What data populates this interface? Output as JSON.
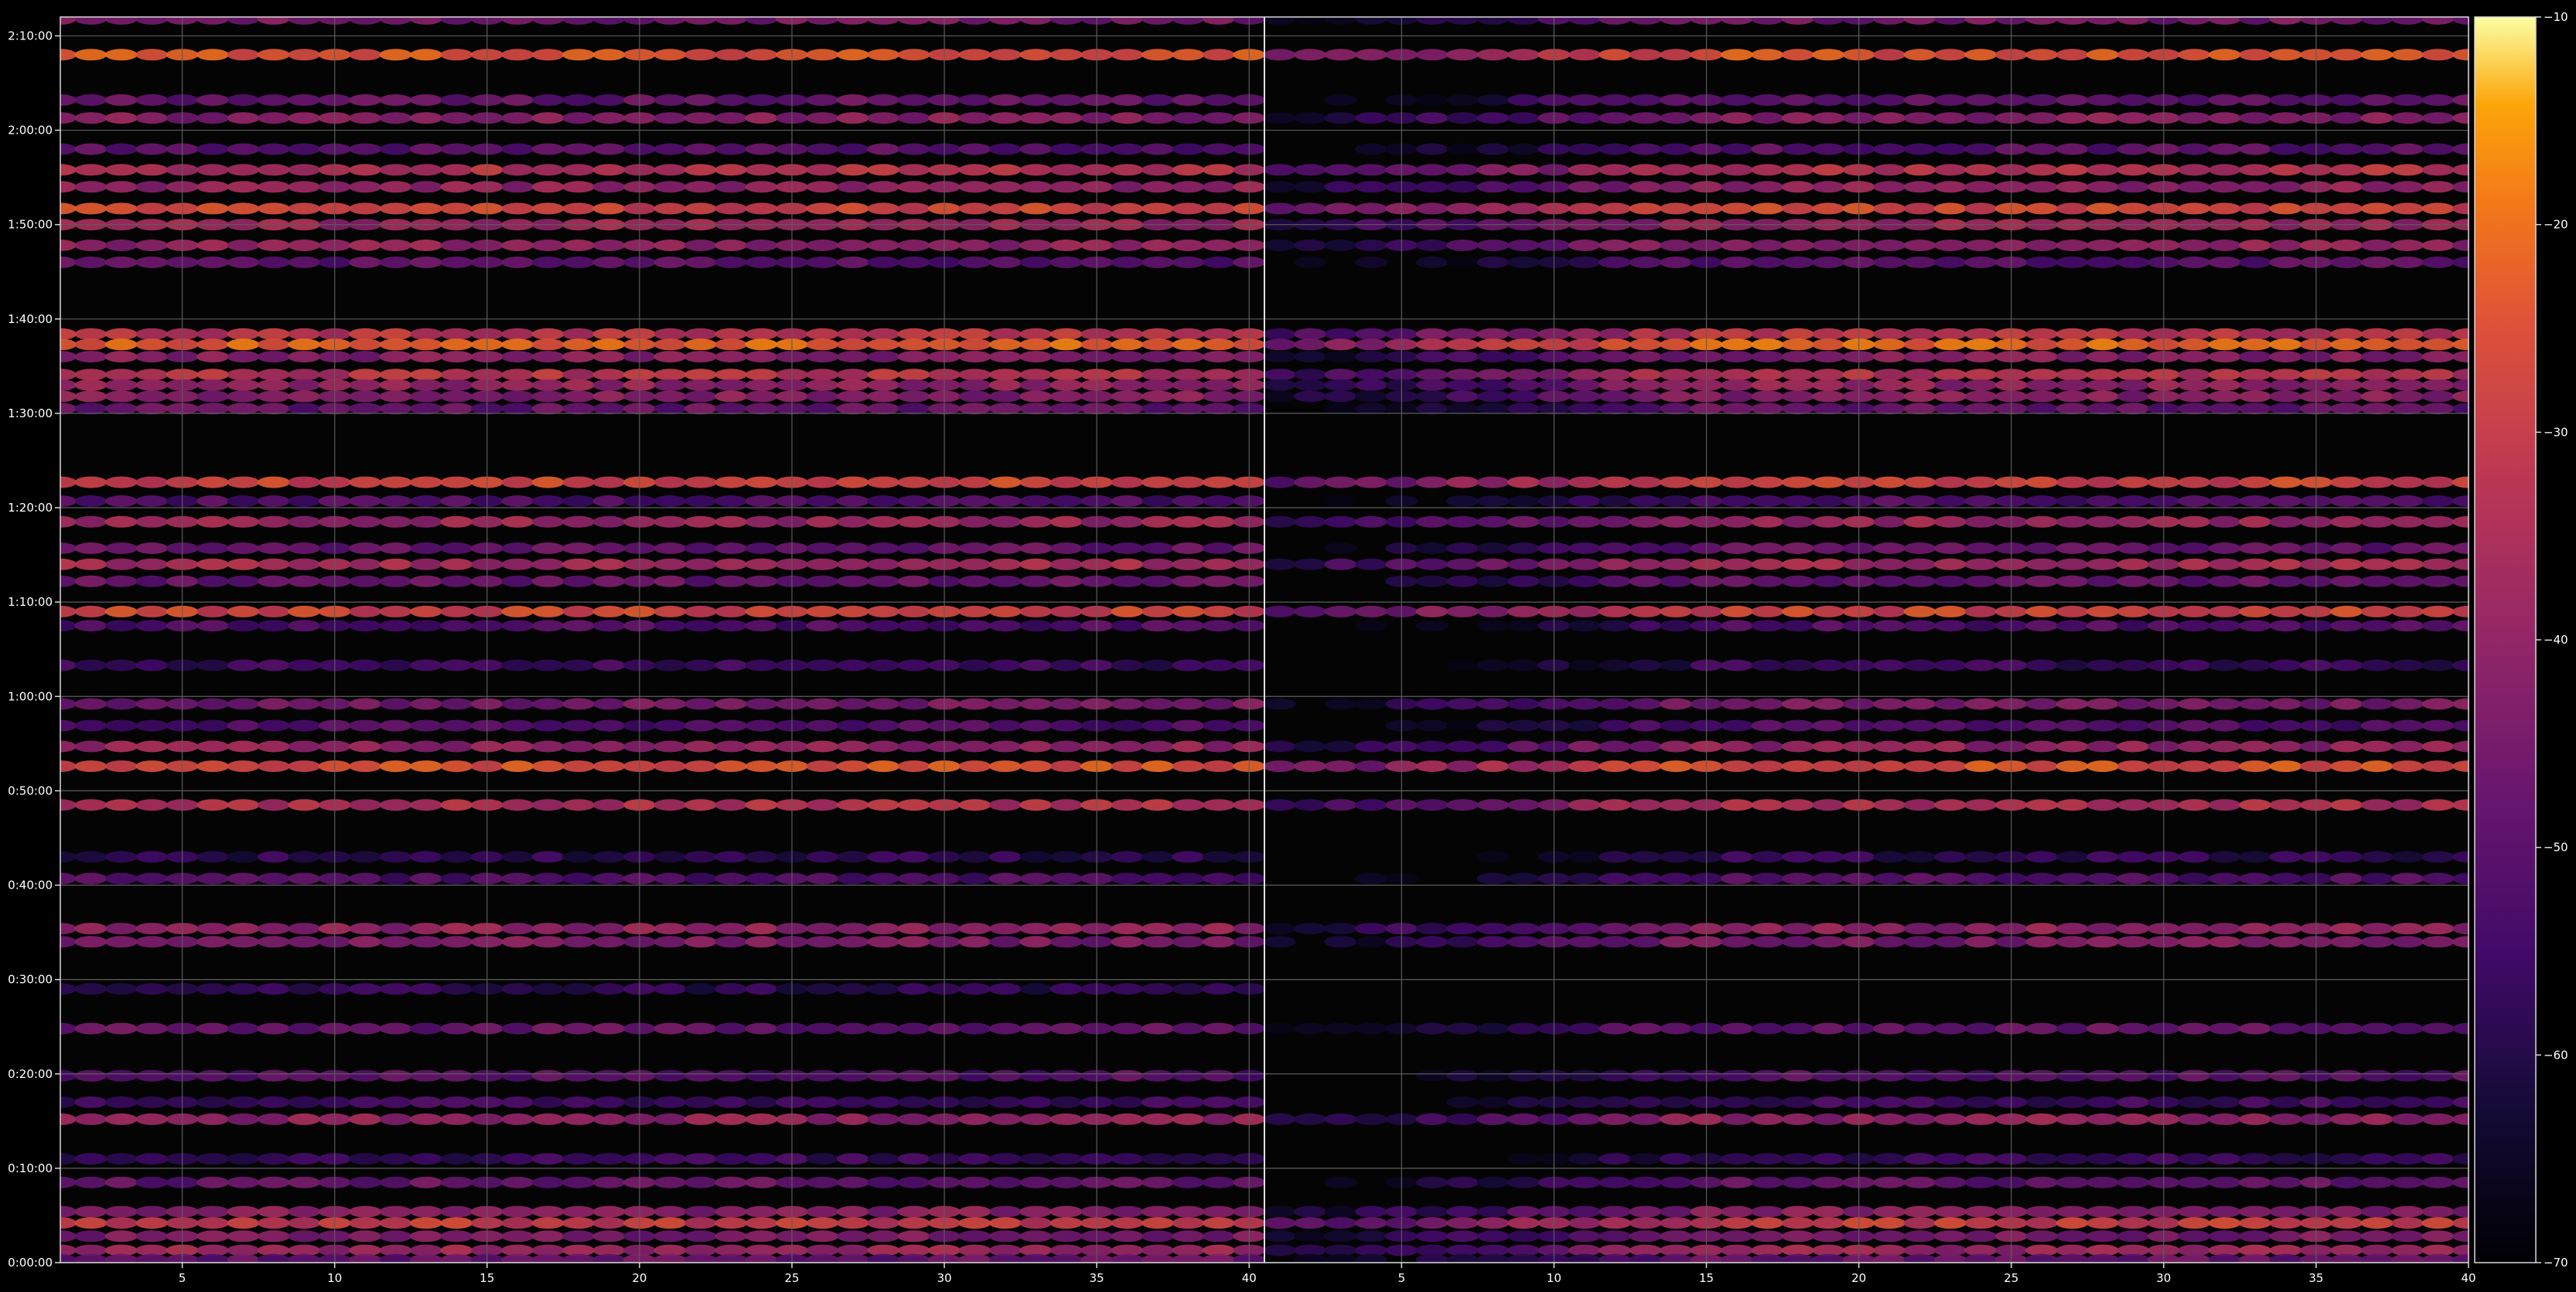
{
  "chart_data": {
    "type": "heatmap",
    "title": "",
    "xlabel": "",
    "ylabel": "",
    "x_range": [
      1,
      80
    ],
    "x_split": 40,
    "xticks": [
      5,
      10,
      15,
      20,
      25,
      30,
      35,
      40,
      45,
      50,
      55,
      60,
      65,
      70,
      75,
      80
    ],
    "xtick_labels": [
      "5",
      "10",
      "15",
      "20",
      "25",
      "30",
      "35",
      "40",
      "5",
      "10",
      "15",
      "20",
      "25",
      "30",
      "35",
      "40"
    ],
    "y_unit": "minutes",
    "y_range": [
      0,
      132
    ],
    "yticks": [
      0,
      10,
      20,
      30,
      40,
      50,
      60,
      70,
      80,
      90,
      100,
      110,
      120,
      130
    ],
    "ytick_labels": [
      "0:00:00",
      "0:10:00",
      "0:20:00",
      "0:30:00",
      "0:40:00",
      "0:50:00",
      "1:00:00",
      "1:10:00",
      "1:20:00",
      "1:30:00",
      "1:40:00",
      "1:50:00",
      "2:00:00",
      "2:10:00"
    ],
    "grid": true,
    "colormap": "inferno",
    "colorbar": {
      "range": [
        -70,
        -10
      ],
      "ticks": [
        -70,
        -60,
        -50,
        -40,
        -30,
        -20,
        -10
      ],
      "tick_labels": [
        "−70",
        "−60",
        "−50",
        "−40",
        "−30",
        "−20",
        "−10"
      ]
    },
    "bands": [
      {
        "y": 131.8,
        "level": -45,
        "panels": "both"
      },
      {
        "y": 128.0,
        "level": -25,
        "panels": "both"
      },
      {
        "y": 123.2,
        "level": -48,
        "panels": "both"
      },
      {
        "y": 121.3,
        "level": -42,
        "panels": "both"
      },
      {
        "y": 118.0,
        "level": -50,
        "panels": "both"
      },
      {
        "y": 115.8,
        "level": -33,
        "panels": "both"
      },
      {
        "y": 114.0,
        "level": -40,
        "panels": "both"
      },
      {
        "y": 111.7,
        "level": -28,
        "panels": "both"
      },
      {
        "y": 110.0,
        "level": -38,
        "panels": "both"
      },
      {
        "y": 107.8,
        "level": -40,
        "panels": "both"
      },
      {
        "y": 106.0,
        "level": -50,
        "panels": "both"
      },
      {
        "y": 98.4,
        "level": -32,
        "panels": "both"
      },
      {
        "y": 97.3,
        "level": -22,
        "panels": "both"
      },
      {
        "y": 96.0,
        "level": -42,
        "panels": "both"
      },
      {
        "y": 94.1,
        "level": -33,
        "panels": "both"
      },
      {
        "y": 93.0,
        "level": -40,
        "panels": "both"
      },
      {
        "y": 91.8,
        "level": -42,
        "panels": "both"
      },
      {
        "y": 90.5,
        "level": -48,
        "panels": "both"
      },
      {
        "y": 82.7,
        "level": -28,
        "panels": "both"
      },
      {
        "y": 80.7,
        "level": -52,
        "panels": "both"
      },
      {
        "y": 78.5,
        "level": -38,
        "panels": "both"
      },
      {
        "y": 75.7,
        "level": -48,
        "panels": "both"
      },
      {
        "y": 74.0,
        "level": -36,
        "panels": "both"
      },
      {
        "y": 72.2,
        "level": -48,
        "panels": "both"
      },
      {
        "y": 69.0,
        "level": -28,
        "panels": "both"
      },
      {
        "y": 67.5,
        "level": -52,
        "panels": "both"
      },
      {
        "y": 63.3,
        "level": -56,
        "panels": "both"
      },
      {
        "y": 59.2,
        "level": -45,
        "panels": "both"
      },
      {
        "y": 56.9,
        "level": -52,
        "panels": "both"
      },
      {
        "y": 54.7,
        "level": -40,
        "panels": "both"
      },
      {
        "y": 52.6,
        "level": -25,
        "panels": "both"
      },
      {
        "y": 48.5,
        "level": -34,
        "panels": "both"
      },
      {
        "y": 43.0,
        "level": -58,
        "panels": "both"
      },
      {
        "y": 40.7,
        "level": -52,
        "panels": "both"
      },
      {
        "y": 35.4,
        "level": -40,
        "panels": "both"
      },
      {
        "y": 34.0,
        "level": -44,
        "panels": "both"
      },
      {
        "y": 29.0,
        "level": -58,
        "panels": "left"
      },
      {
        "y": 24.8,
        "level": -48,
        "panels": "both"
      },
      {
        "y": 19.8,
        "level": -50,
        "panels": "both"
      },
      {
        "y": 17.0,
        "level": -55,
        "panels": "both"
      },
      {
        "y": 15.2,
        "level": -40,
        "panels": "both"
      },
      {
        "y": 11.0,
        "level": -56,
        "panels": "both"
      },
      {
        "y": 8.5,
        "level": -48,
        "panels": "both"
      },
      {
        "y": 5.4,
        "level": -42,
        "panels": "both"
      },
      {
        "y": 4.2,
        "level": -30,
        "panels": "both"
      },
      {
        "y": 2.8,
        "level": -44,
        "panels": "both"
      },
      {
        "y": 1.3,
        "level": -38,
        "panels": "both"
      },
      {
        "y": 0.3,
        "level": -48,
        "panels": "both"
      }
    ]
  }
}
